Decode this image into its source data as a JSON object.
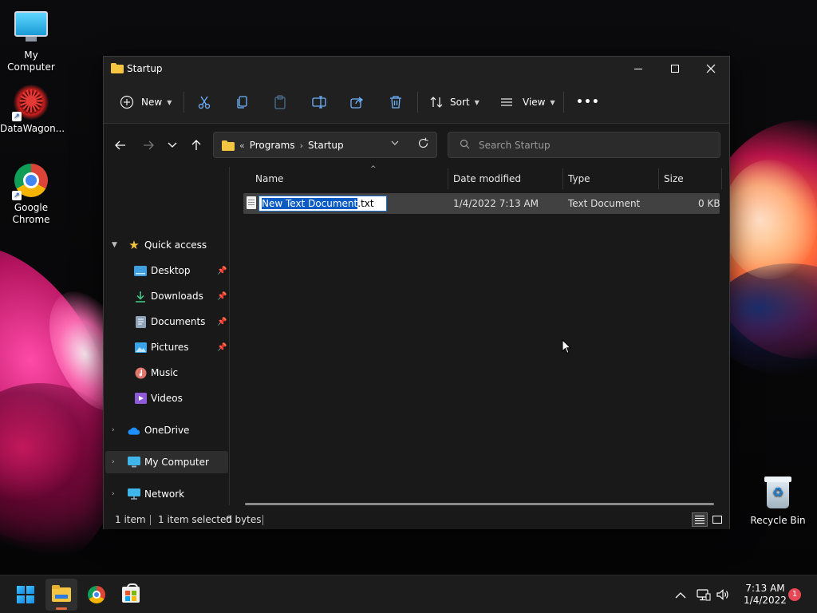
{
  "desktop": {
    "icons": [
      {
        "label": "My Computer",
        "icon": "monitor-icon"
      },
      {
        "label": "DataWagon...",
        "icon": "datawagon-icon"
      },
      {
        "label": "Google Chrome",
        "icon": "chrome-icon"
      },
      {
        "label": "Recycle Bin",
        "icon": "recycle-bin-icon"
      }
    ]
  },
  "window": {
    "title": "Startup",
    "controls": {
      "minimize": "—",
      "maximize": "□",
      "close": "✕"
    }
  },
  "toolbar": {
    "new_label": "New",
    "sort_label": "Sort",
    "view_label": "View",
    "more_label": "•••",
    "icons": [
      "plus-circle-icon",
      "cut-icon",
      "copy-icon",
      "paste-icon",
      "rename-icon",
      "share-icon",
      "delete-icon",
      "sort-icon",
      "view-icon"
    ]
  },
  "address": {
    "overflow": "«",
    "crumbs": [
      "Programs",
      "Startup"
    ],
    "separator": "›",
    "search_placeholder": "Search Startup"
  },
  "navpane": {
    "quick_access": "Quick access",
    "items": [
      {
        "label": "Desktop",
        "pinned": true
      },
      {
        "label": "Downloads",
        "pinned": true
      },
      {
        "label": "Documents",
        "pinned": true
      },
      {
        "label": "Pictures",
        "pinned": true
      },
      {
        "label": "Music",
        "pinned": false
      },
      {
        "label": "Videos",
        "pinned": false
      }
    ],
    "onedrive": "OneDrive",
    "my_computer": "My Computer",
    "network": "Network"
  },
  "columns": {
    "name": "Name",
    "date": "Date modified",
    "type": "Type",
    "size": "Size"
  },
  "files": [
    {
      "name_selected": "New Text Document",
      "name_ext": ".txt",
      "date": "1/4/2022 7:13 AM",
      "type": "Text Document",
      "size": "0 KB"
    }
  ],
  "status": {
    "count": "1 item",
    "selected": "1 item selected",
    "bytes": "0 bytes"
  },
  "taskbar": {
    "time": "7:13 AM",
    "date": "1/4/2022",
    "notifications": "1",
    "tray_chevron": "^"
  },
  "colors": {
    "accent": "#0a5bc4",
    "window_bg": "#191919",
    "chrome_bg": "#202020",
    "selected_row": "#414141",
    "notification": "#e74856"
  }
}
